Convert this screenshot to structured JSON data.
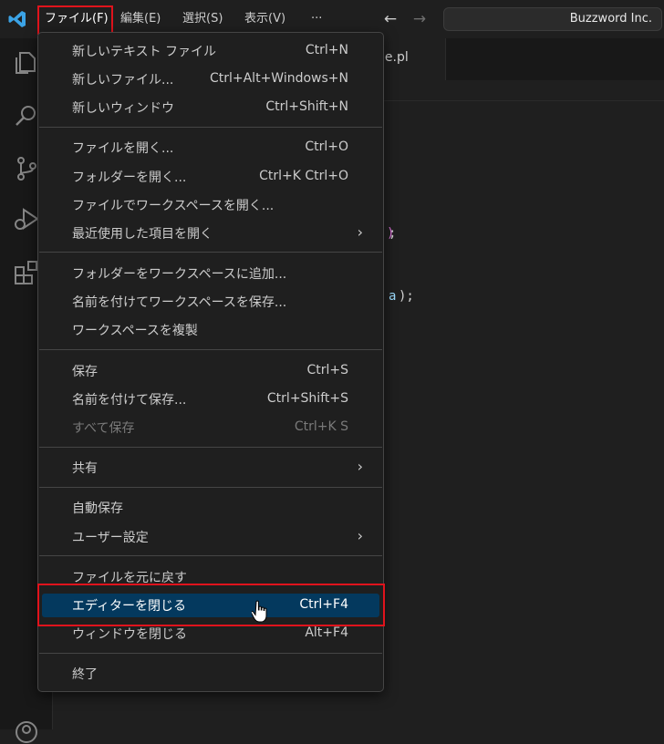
{
  "menubar": {
    "items": [
      "ファイル(F)",
      "編集(E)",
      "選択(S)",
      "表示(V)",
      "···"
    ],
    "search_text": "Buzzword Inc."
  },
  "activitybar": {
    "icons": [
      "explorer-icon",
      "search-icon",
      "source-control-icon",
      "run-debug-icon",
      "extensions-icon",
      "account-icon"
    ]
  },
  "editor": {
    "tab_label": "le.pl",
    "code": [
      ")",
      ";",
      "a",
      ");"
    ]
  },
  "file_menu": {
    "groups": [
      [
        {
          "label": "新しいテキスト ファイル",
          "shortcut": "Ctrl+N"
        },
        {
          "label": "新しいファイル...",
          "shortcut": "Ctrl+Alt+Windows+N"
        },
        {
          "label": "新しいウィンドウ",
          "shortcut": "Ctrl+Shift+N"
        }
      ],
      [
        {
          "label": "ファイルを開く...",
          "shortcut": "Ctrl+O"
        },
        {
          "label": "フォルダーを開く...",
          "shortcut": "Ctrl+K Ctrl+O"
        },
        {
          "label": "ファイルでワークスペースを開く...",
          "shortcut": ""
        },
        {
          "label": "最近使用した項目を開く",
          "shortcut": "",
          "submenu": true
        }
      ],
      [
        {
          "label": "フォルダーをワークスペースに追加...",
          "shortcut": ""
        },
        {
          "label": "名前を付けてワークスペースを保存...",
          "shortcut": ""
        },
        {
          "label": "ワークスペースを複製",
          "shortcut": ""
        }
      ],
      [
        {
          "label": "保存",
          "shortcut": "Ctrl+S"
        },
        {
          "label": "名前を付けて保存...",
          "shortcut": "Ctrl+Shift+S"
        },
        {
          "label": "すべて保存",
          "shortcut": "Ctrl+K S",
          "disabled": true
        }
      ],
      [
        {
          "label": "共有",
          "shortcut": "",
          "submenu": true
        }
      ],
      [
        {
          "label": "自動保存",
          "shortcut": ""
        },
        {
          "label": "ユーザー設定",
          "shortcut": "",
          "submenu": true
        }
      ],
      [
        {
          "label": "ファイルを元に戻す",
          "shortcut": ""
        },
        {
          "label": "エディターを閉じる",
          "shortcut": "Ctrl+F4",
          "selected": true
        },
        {
          "label": "ウィンドウを閉じる",
          "shortcut": "Alt+F4"
        }
      ],
      [
        {
          "label": "終了",
          "shortcut": ""
        }
      ]
    ]
  },
  "colors": {
    "accent_highlight": "#04395e",
    "annotation_red": "#e0131c",
    "vscode_blue": "#3ba3e6"
  }
}
